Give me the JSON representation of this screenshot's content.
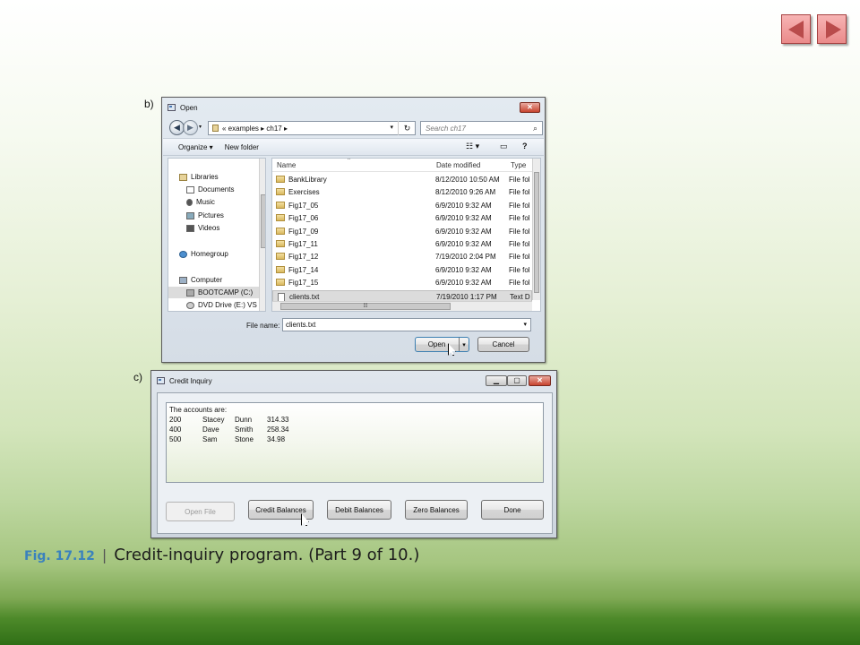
{
  "labels": {
    "part_b": "b)",
    "part_c": "c)"
  },
  "open_dialog": {
    "title": "Open",
    "address": "«  examples  ▸  ch17  ▸",
    "search_placeholder": "Search ch17",
    "organize": "Organize ▾",
    "new_folder": "New folder",
    "nav": [
      "Libraries",
      "Documents",
      "Music",
      "Pictures",
      "Videos",
      "Homegroup",
      "Computer",
      "BOOTCAMP (C:)",
      "DVD Drive (E:) VS"
    ],
    "columns": {
      "name": "Name",
      "date": "Date modified",
      "type": "Type"
    },
    "files": [
      {
        "name": "BankLibrary",
        "date": "8/12/2010 10:50 AM",
        "type": "File fol"
      },
      {
        "name": "Exercises",
        "date": "8/12/2010 9:26 AM",
        "type": "File fol"
      },
      {
        "name": "Fig17_05",
        "date": "6/9/2010 9:32 AM",
        "type": "File fol"
      },
      {
        "name": "Fig17_06",
        "date": "6/9/2010 9:32 AM",
        "type": "File fol"
      },
      {
        "name": "Fig17_09",
        "date": "6/9/2010 9:32 AM",
        "type": "File fol"
      },
      {
        "name": "Fig17_11",
        "date": "6/9/2010 9:32 AM",
        "type": "File fol"
      },
      {
        "name": "Fig17_12",
        "date": "7/19/2010 2:04 PM",
        "type": "File fol"
      },
      {
        "name": "Fig17_14",
        "date": "6/9/2010 9:32 AM",
        "type": "File fol"
      },
      {
        "name": "Fig17_15",
        "date": "6/9/2010 9:32 AM",
        "type": "File fol"
      },
      {
        "name": "clients.txt",
        "date": "7/19/2010 1:17 PM",
        "type": "Text D"
      }
    ],
    "file_name_label": "File name:",
    "file_name_value": "clients.txt",
    "open_btn": "Open",
    "cancel_btn": "Cancel"
  },
  "credit_window": {
    "title": "Credit Inquiry",
    "output_header": "The accounts are:",
    "accounts": [
      {
        "account": "200",
        "first": "Stacey",
        "last": "Dunn",
        "balance": "314.33"
      },
      {
        "account": "400",
        "first": "Dave",
        "last": "Smith",
        "balance": "258.34"
      },
      {
        "account": "500",
        "first": "Sam",
        "last": "Stone",
        "balance": "34.98"
      }
    ],
    "buttons": {
      "open_file": "Open File",
      "credit": "Credit Balances",
      "debit": "Debit Balances",
      "zero": "Zero Balances",
      "done": "Done"
    }
  },
  "caption": {
    "fig": "Fig. 17.12",
    "sep": "|",
    "text": "Credit-inquiry program. (Part 9 of 10.)"
  }
}
